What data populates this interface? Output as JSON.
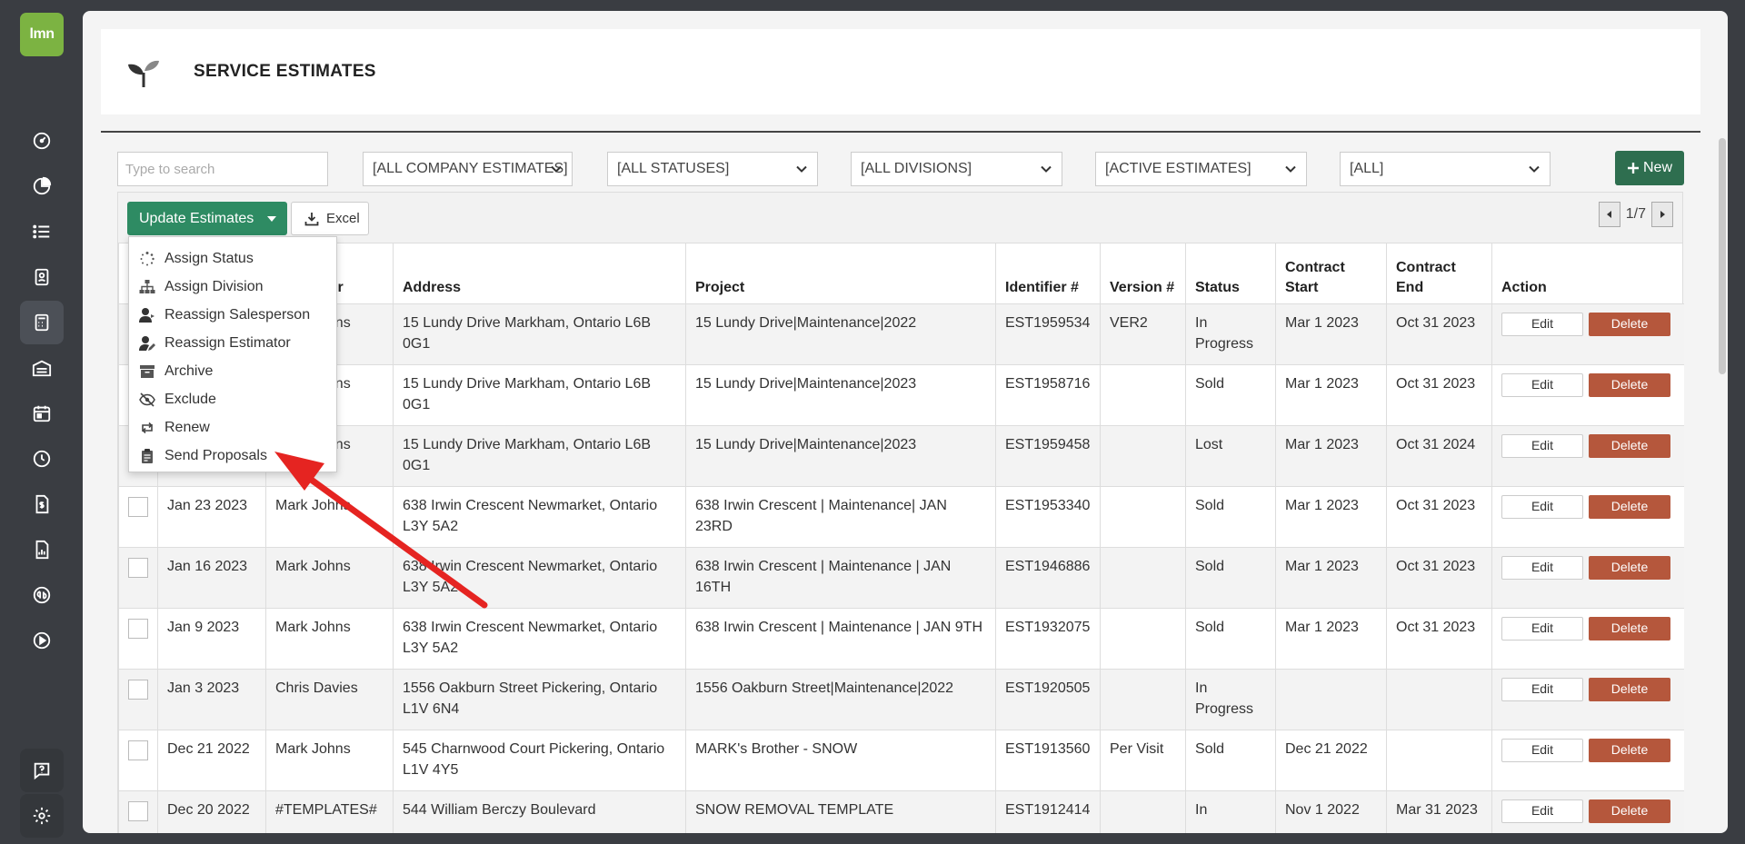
{
  "logo": {
    "text": "lmn"
  },
  "page": {
    "title": "SERVICE ESTIMATES"
  },
  "filters": {
    "search_placeholder": "Type to search",
    "company": "[ALL COMPANY ESTIMATES]",
    "statuses": "[ALL STATUSES]",
    "divisions": "[ALL DIVISIONS]",
    "active": "[ACTIVE ESTIMATES]",
    "all": "[ALL]",
    "new_label": "New"
  },
  "toolbar": {
    "update_label": "Update Estimates",
    "excel_label": "Excel",
    "pager": "1/7"
  },
  "menu": {
    "items": [
      "Assign Status",
      "Assign Division",
      "Reassign Salesperson",
      "Reassign Estimator",
      "Archive",
      "Exclude",
      "Renew",
      "Send Proposals"
    ]
  },
  "table": {
    "headers": [
      "",
      "Date",
      "Customer",
      "Address",
      "Project",
      "Identifier #",
      "Version #",
      "Status",
      "Contract Start",
      "Contract End",
      "Action"
    ],
    "edit_label": "Edit",
    "delete_label": "Delete",
    "rows": [
      {
        "date": "",
        "customer": "Mark Johns",
        "address": "15 Lundy Drive Markham, Ontario L6B 0G1",
        "project": "15 Lundy Drive|Maintenance|2022",
        "id": "EST1959534",
        "version": "VER2",
        "status": "In Progress",
        "start": "Mar 1 2023",
        "end": "Oct 31 2023"
      },
      {
        "date": "",
        "customer": "Mark Johns",
        "address": "15 Lundy Drive Markham, Ontario L6B 0G1",
        "project": "15 Lundy Drive|Maintenance|2023",
        "id": "EST1958716",
        "version": "",
        "status": "Sold",
        "start": "Mar 1 2023",
        "end": "Oct 31 2023"
      },
      {
        "date": "",
        "customer": "Mark Johns",
        "address": "15 Lundy Drive Markham, Ontario L6B 0G1",
        "project": "15 Lundy Drive|Maintenance|2023",
        "id": "EST1959458",
        "version": "",
        "status": "Lost",
        "start": "Mar 1 2023",
        "end": "Oct 31 2024"
      },
      {
        "date": "Jan 23 2023",
        "customer": "Mark Johns",
        "address": "638 Irwin Crescent Newmarket, Ontario L3Y 5A2",
        "project": "638 Irwin Crescent | Maintenance| JAN 23RD",
        "id": "EST1953340",
        "version": "",
        "status": "Sold",
        "start": "Mar 1 2023",
        "end": "Oct 31 2023"
      },
      {
        "date": "Jan 16 2023",
        "customer": "Mark Johns",
        "address": "638 Irwin Crescent Newmarket, Ontario L3Y 5A2",
        "project": "638 Irwin Crescent | Maintenance | JAN 16TH",
        "id": "EST1946886",
        "version": "",
        "status": "Sold",
        "start": "Mar 1 2023",
        "end": "Oct 31 2023"
      },
      {
        "date": "Jan 9 2023",
        "customer": "Mark Johns",
        "address": "638 Irwin Crescent Newmarket, Ontario L3Y 5A2",
        "project": "638 Irwin Crescent | Maintenance | JAN 9TH",
        "id": "EST1932075",
        "version": "",
        "status": "Sold",
        "start": "Mar 1 2023",
        "end": "Oct 31 2023"
      },
      {
        "date": "Jan 3 2023",
        "customer": "Chris Davies",
        "address": "1556 Oakburn Street Pickering, Ontario L1V 6N4",
        "project": "1556 Oakburn Street|Maintenance|2022",
        "id": "EST1920505",
        "version": "",
        "status": "In Progress",
        "start": "",
        "end": ""
      },
      {
        "date": "Dec 21 2022",
        "customer": "Mark Johns",
        "address": "545 Charnwood Court Pickering, Ontario L1V 4Y5",
        "project": "MARK's Brother - SNOW",
        "id": "EST1913560",
        "version": "Per Visit",
        "status": "Sold",
        "start": "Dec 21 2022",
        "end": ""
      },
      {
        "date": "Dec 20 2022",
        "customer": "#TEMPLATES#",
        "address": "544 William Berczy Boulevard",
        "project": "SNOW REMOVAL TEMPLATE",
        "id": "EST1912414",
        "version": "",
        "status": "In",
        "start": "Nov 1 2022",
        "end": "Mar 31 2023"
      }
    ]
  },
  "colors": {
    "sidebar": "#3a3d42",
    "logo": "#7cb342",
    "primary_green": "#2e8b63",
    "new_green": "#2e6e4f",
    "delete": "#b5573c",
    "arrow": "#e52421"
  }
}
